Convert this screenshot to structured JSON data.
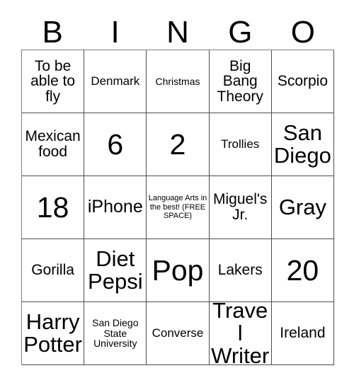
{
  "card": {
    "header_letters": [
      "B",
      "I",
      "N",
      "G",
      "O"
    ],
    "rows": [
      [
        {
          "text": "To be able to fly",
          "size": "fs-m"
        },
        {
          "text": "Denmark",
          "size": "fs-s"
        },
        {
          "text": "Christmas",
          "size": "fs-xs"
        },
        {
          "text": "Big Bang Theory",
          "size": "fs-m"
        },
        {
          "text": "Scorpio",
          "size": "fs-m"
        }
      ],
      [
        {
          "text": "Mexican food",
          "size": "fs-m"
        },
        {
          "text": "6",
          "size": "fs-xxl"
        },
        {
          "text": "2",
          "size": "fs-xxl"
        },
        {
          "text": "Trollies",
          "size": "fs-s"
        },
        {
          "text": "San Diego",
          "size": "fs-xl"
        }
      ],
      [
        {
          "text": "18",
          "size": "fs-xxl"
        },
        {
          "text": "iPhone",
          "size": "fs-l"
        },
        {
          "text": "Language Arts in the best! (FREE SPACE)",
          "size": "fs-xxs"
        },
        {
          "text": "Miguel's Jr.",
          "size": "fs-m"
        },
        {
          "text": "Gray",
          "size": "fs-xl"
        }
      ],
      [
        {
          "text": "Gorilla",
          "size": "fs-m"
        },
        {
          "text": "Diet Pepsi",
          "size": "fs-xl"
        },
        {
          "text": "Pop",
          "size": "fs-xxl"
        },
        {
          "text": "Lakers",
          "size": "fs-m"
        },
        {
          "text": "20",
          "size": "fs-xxl"
        }
      ],
      [
        {
          "text": "Harry Potter",
          "size": "fs-xl"
        },
        {
          "text": "San Diego State University",
          "size": "fs-xs"
        },
        {
          "text": "Converse",
          "size": "fs-s"
        },
        {
          "text": "Travel Writer",
          "size": "fs-xl"
        },
        {
          "text": "Ireland",
          "size": "fs-m"
        }
      ]
    ]
  },
  "colors": {
    "background": "#ffffff",
    "text": "#000000",
    "grid_line": "#4d4d4d"
  }
}
